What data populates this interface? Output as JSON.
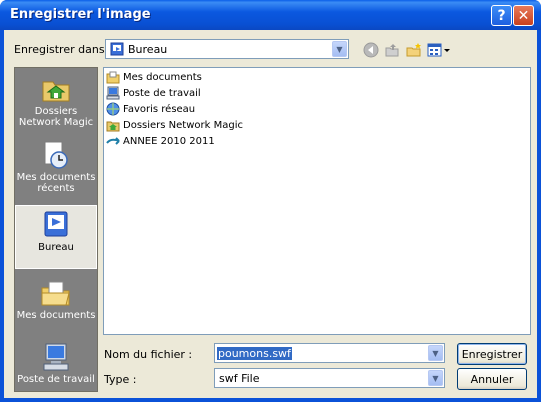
{
  "window": {
    "title": "Enregistrer l'image",
    "help_label": "?",
    "close_label": "✕"
  },
  "toolbar": {
    "save_in_label": "Enregistrer dans :",
    "location": "Bureau",
    "icons": [
      "back-icon",
      "up-folder-icon",
      "new-folder-icon",
      "view-menu-icon"
    ]
  },
  "places": [
    {
      "label": "Dossiers Network Magic",
      "icon": "network-folder-icon"
    },
    {
      "label": "Mes documents récents",
      "icon": "recent-documents-icon"
    },
    {
      "label": "Bureau",
      "icon": "desktop-icon",
      "selected": true
    },
    {
      "label": "Mes documents",
      "icon": "my-documents-icon"
    },
    {
      "label": "Poste de travail",
      "icon": "my-computer-icon"
    }
  ],
  "files": [
    {
      "label": "Mes documents",
      "icon": "folder-documents-icon"
    },
    {
      "label": "Poste de travail",
      "icon": "computer-icon"
    },
    {
      "label": "Favoris réseau",
      "icon": "network-places-icon"
    },
    {
      "label": "Dossiers Network Magic",
      "icon": "network-folder-icon"
    },
    {
      "label": "ANNEE 2010 2011",
      "icon": "shortcut-icon"
    }
  ],
  "form": {
    "filename_label": "Nom du fichier :",
    "filename_value": "poumons.swf",
    "type_label": "Type :",
    "type_value": "swf File",
    "save_button": "Enregistrer",
    "cancel_button": "Annuler"
  },
  "colors": {
    "titlebar": "#0b58e0",
    "dialog_bg": "#ece9d8",
    "places_bg": "#808080",
    "selection": "#316ac5"
  }
}
